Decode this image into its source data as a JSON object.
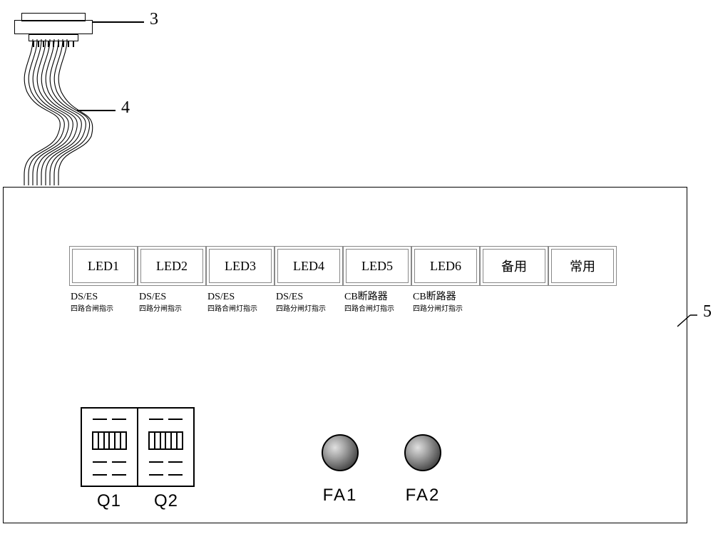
{
  "callouts": {
    "c3": "3",
    "c4": "4",
    "c5": "5"
  },
  "leds": [
    "LED1",
    "LED2",
    "LED3",
    "LED4",
    "LED5",
    "LED6",
    "备用",
    "常用"
  ],
  "labels": [
    {
      "l1": "DS/ES",
      "l2": "四路合闸指示"
    },
    {
      "l1": "DS/ES",
      "l2": "四路分闸指示"
    },
    {
      "l1": "DS/ES",
      "l2": "四路合闸灯指示"
    },
    {
      "l1": "DS/ES",
      "l2": "四路分闸灯指示"
    },
    {
      "l1": "CB断路器",
      "l2": "四路合闸灯指示"
    },
    {
      "l1": "CB断路器",
      "l2": "四路分闸灯指示"
    }
  ],
  "switches": {
    "q1": "Q1",
    "q2": "Q2"
  },
  "fuses": {
    "fa1": "FA1",
    "fa2": "FA2"
  }
}
